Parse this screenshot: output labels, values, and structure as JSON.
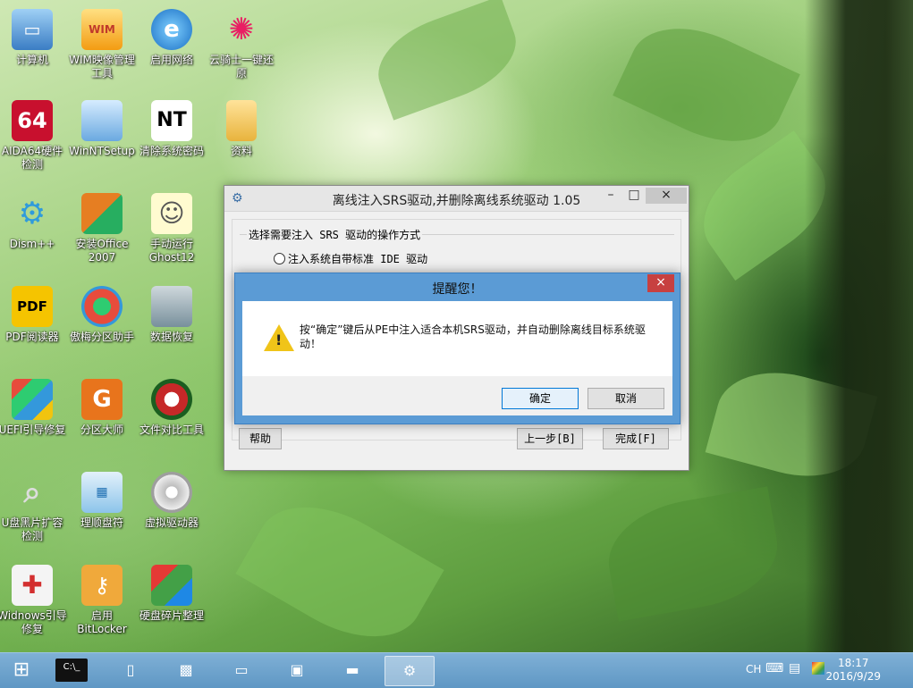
{
  "desktop": {
    "icons": [
      {
        "label": "计算机",
        "icon": "computer-icon"
      },
      {
        "label": "WIM映像管理工具",
        "icon": "wim-icon"
      },
      {
        "label": "启用网络",
        "icon": "network-icon"
      },
      {
        "label": "云骑士一键还原",
        "icon": "restore-icon"
      },
      {
        "label": "AIDA64硬件检测",
        "icon": "aida64-icon"
      },
      {
        "label": "WinNTSetup",
        "icon": "setup-icon"
      },
      {
        "label": "清除系统密码",
        "icon": "password-icon"
      },
      {
        "label": "资料",
        "icon": "folder-icon"
      },
      {
        "label": "Dism++",
        "icon": "gear-icon"
      },
      {
        "label": "安装Office 2007",
        "icon": "office-icon"
      },
      {
        "label": "手动运行Ghost12",
        "icon": "ghost-icon"
      },
      {
        "label": "PDF阅读器",
        "icon": "pdf-icon"
      },
      {
        "label": "傲梅分区助手",
        "icon": "partition-icon"
      },
      {
        "label": "数据恢复",
        "icon": "recovery-icon"
      },
      {
        "label": "UEFI引导修复",
        "icon": "uefi-icon"
      },
      {
        "label": "分区大师",
        "icon": "diskgenius-icon"
      },
      {
        "label": "文件对比工具",
        "icon": "compare-icon"
      },
      {
        "label": "U盘黑片扩容检测",
        "icon": "usb-check-icon"
      },
      {
        "label": "理顺盘符",
        "icon": "drive-letter-icon"
      },
      {
        "label": "虚拟驱动器",
        "icon": "virtual-drive-icon"
      },
      {
        "label": "Widnows引导修复",
        "icon": "boot-repair-icon"
      },
      {
        "label": "启用BitLocker",
        "icon": "bitlocker-icon"
      },
      {
        "label": "硬盘碎片整理",
        "icon": "defrag-icon"
      }
    ]
  },
  "main_window": {
    "title": "离线注入SRS驱动,并删除离线系统驱动 1.05",
    "minimize": "–",
    "maximize": "□",
    "close": "×",
    "group_title": "选择需要注入 SRS 驱动的操作方式",
    "radio_option": "注入系统自带标准 IDE 驱动",
    "help_button": "帮助",
    "back_button": "上一步[B]",
    "finish_button": "完成[F]"
  },
  "dialog": {
    "title": "提醒您！",
    "close": "×",
    "message": "按“确定”键后从PE中注入适合本机SRS驱动，并自动删除离线目标系统驱动！",
    "ok_button": "确定",
    "cancel_button": "取消"
  },
  "taskbar": {
    "language": "CH",
    "time": "18:17",
    "date": "2016/9/29"
  }
}
